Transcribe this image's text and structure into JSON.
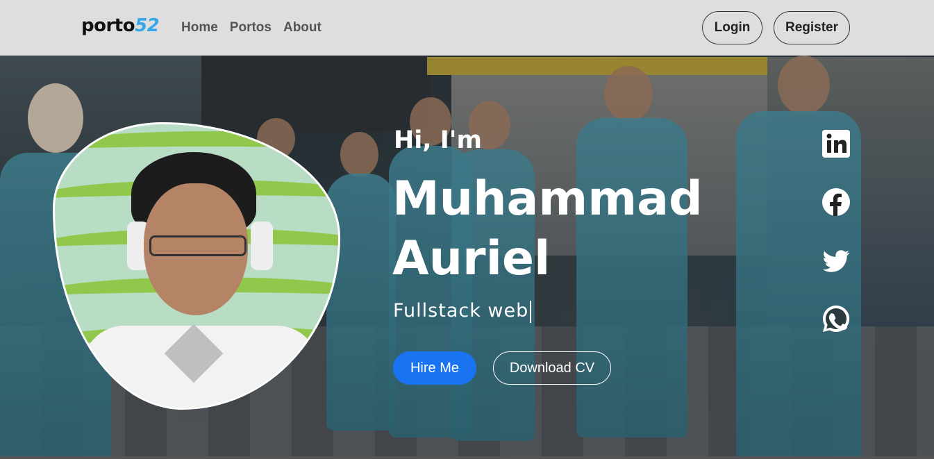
{
  "navbar": {
    "logo_text": "porto",
    "logo_number": "52",
    "links": [
      "Home",
      "Portos",
      "About"
    ],
    "login_label": "Login",
    "register_label": "Register"
  },
  "hero": {
    "greeting": "Hi, I'm",
    "name_line1": "Muhammad",
    "name_line2": "Auriel",
    "role": "Fullstack web",
    "hire_label": "Hire Me",
    "cv_label": "Download CV"
  },
  "social": {
    "icons": [
      "linkedin-icon",
      "facebook-icon",
      "twitter-icon",
      "whatsapp-icon"
    ]
  },
  "colors": {
    "accent": "#1a73f0",
    "navbar_bg": "#dedede",
    "logo_number": "#35a7e8"
  }
}
